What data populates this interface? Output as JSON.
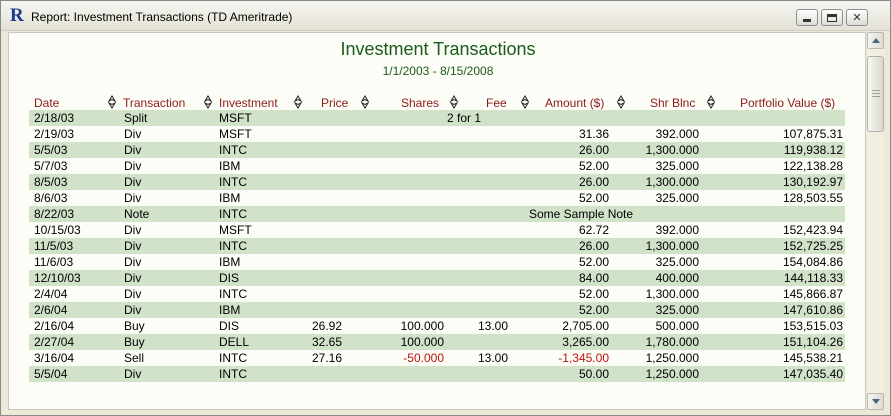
{
  "window": {
    "title": "Report: Investment Transactions (TD Ameritrade)",
    "icon": "R"
  },
  "report": {
    "title": "Investment Transactions",
    "subtitle": "1/1/2003 - 8/15/2008"
  },
  "columns": [
    {
      "key": "date",
      "label": "Date"
    },
    {
      "key": "transaction",
      "label": "Transaction"
    },
    {
      "key": "investment",
      "label": "Investment"
    },
    {
      "key": "price",
      "label": "Price"
    },
    {
      "key": "shares",
      "label": "Shares"
    },
    {
      "key": "fee",
      "label": "Fee"
    },
    {
      "key": "amount",
      "label": "Amount ($)"
    },
    {
      "key": "shr_blnc",
      "label": "Shr Blnc"
    },
    {
      "key": "portfolio_value",
      "label": "Portfolio Value ($)"
    }
  ],
  "colors": {
    "header_text": "#8b1a1a",
    "title_text": "#1a5a1a",
    "row_shade": "#d2e2c8",
    "negative": "#c01010"
  },
  "rows": [
    {
      "date": "2/18/03",
      "transaction": "Split",
      "investment": "MSFT",
      "price": "",
      "shares": "",
      "fee": "",
      "amount": "",
      "shr_blnc": "",
      "portfolio_value": "",
      "note": "2 for 1"
    },
    {
      "date": "2/19/03",
      "transaction": "Div",
      "investment": "MSFT",
      "price": "",
      "shares": "",
      "fee": "",
      "amount": "31.36",
      "shr_blnc": "392.000",
      "portfolio_value": "107,875.31"
    },
    {
      "date": "5/5/03",
      "transaction": "Div",
      "investment": "INTC",
      "price": "",
      "shares": "",
      "fee": "",
      "amount": "26.00",
      "shr_blnc": "1,300.000",
      "portfolio_value": "119,938.12"
    },
    {
      "date": "5/7/03",
      "transaction": "Div",
      "investment": "IBM",
      "price": "",
      "shares": "",
      "fee": "",
      "amount": "52.00",
      "shr_blnc": "325.000",
      "portfolio_value": "122,138.28"
    },
    {
      "date": "8/5/03",
      "transaction": "Div",
      "investment": "INTC",
      "price": "",
      "shares": "",
      "fee": "",
      "amount": "26.00",
      "shr_blnc": "1,300.000",
      "portfolio_value": "130,192.97"
    },
    {
      "date": "8/6/03",
      "transaction": "Div",
      "investment": "IBM",
      "price": "",
      "shares": "",
      "fee": "",
      "amount": "52.00",
      "shr_blnc": "325.000",
      "portfolio_value": "128,503.55"
    },
    {
      "date": "8/22/03",
      "transaction": "Note",
      "investment": "INTC",
      "price": "",
      "shares": "",
      "fee": "",
      "amount": "",
      "shr_blnc": "",
      "portfolio_value": "",
      "note": "Some Sample Note"
    },
    {
      "date": "10/15/03",
      "transaction": "Div",
      "investment": "MSFT",
      "price": "",
      "shares": "",
      "fee": "",
      "amount": "62.72",
      "shr_blnc": "392.000",
      "portfolio_value": "152,423.94"
    },
    {
      "date": "11/5/03",
      "transaction": "Div",
      "investment": "INTC",
      "price": "",
      "shares": "",
      "fee": "",
      "amount": "26.00",
      "shr_blnc": "1,300.000",
      "portfolio_value": "152,725.25"
    },
    {
      "date": "11/6/03",
      "transaction": "Div",
      "investment": "IBM",
      "price": "",
      "shares": "",
      "fee": "",
      "amount": "52.00",
      "shr_blnc": "325.000",
      "portfolio_value": "154,084.86"
    },
    {
      "date": "12/10/03",
      "transaction": "Div",
      "investment": "DIS",
      "price": "",
      "shares": "",
      "fee": "",
      "amount": "84.00",
      "shr_blnc": "400.000",
      "portfolio_value": "144,118.33"
    },
    {
      "date": "2/4/04",
      "transaction": "Div",
      "investment": "INTC",
      "price": "",
      "shares": "",
      "fee": "",
      "amount": "52.00",
      "shr_blnc": "1,300.000",
      "portfolio_value": "145,866.87"
    },
    {
      "date": "2/6/04",
      "transaction": "Div",
      "investment": "IBM",
      "price": "",
      "shares": "",
      "fee": "",
      "amount": "52.00",
      "shr_blnc": "325.000",
      "portfolio_value": "147,610.86"
    },
    {
      "date": "2/16/04",
      "transaction": "Buy",
      "investment": "DIS",
      "price": "26.92",
      "shares": "100.000",
      "fee": "13.00",
      "amount": "2,705.00",
      "shr_blnc": "500.000",
      "portfolio_value": "153,515.03"
    },
    {
      "date": "2/27/04",
      "transaction": "Buy",
      "investment": "DELL",
      "price": "32.65",
      "shares": "100.000",
      "fee": "",
      "amount": "3,265.00",
      "shr_blnc": "1,780.000",
      "portfolio_value": "151,104.26"
    },
    {
      "date": "3/16/04",
      "transaction": "Sell",
      "investment": "INTC",
      "price": "27.16",
      "shares": "-50.000",
      "fee": "13.00",
      "amount": "-1,345.00",
      "shr_blnc": "1,250.000",
      "portfolio_value": "145,538.21"
    },
    {
      "date": "5/5/04",
      "transaction": "Div",
      "investment": "INTC",
      "price": "",
      "shares": "",
      "fee": "",
      "amount": "50.00",
      "shr_blnc": "1,250.000",
      "portfolio_value": "147,035.40"
    }
  ]
}
